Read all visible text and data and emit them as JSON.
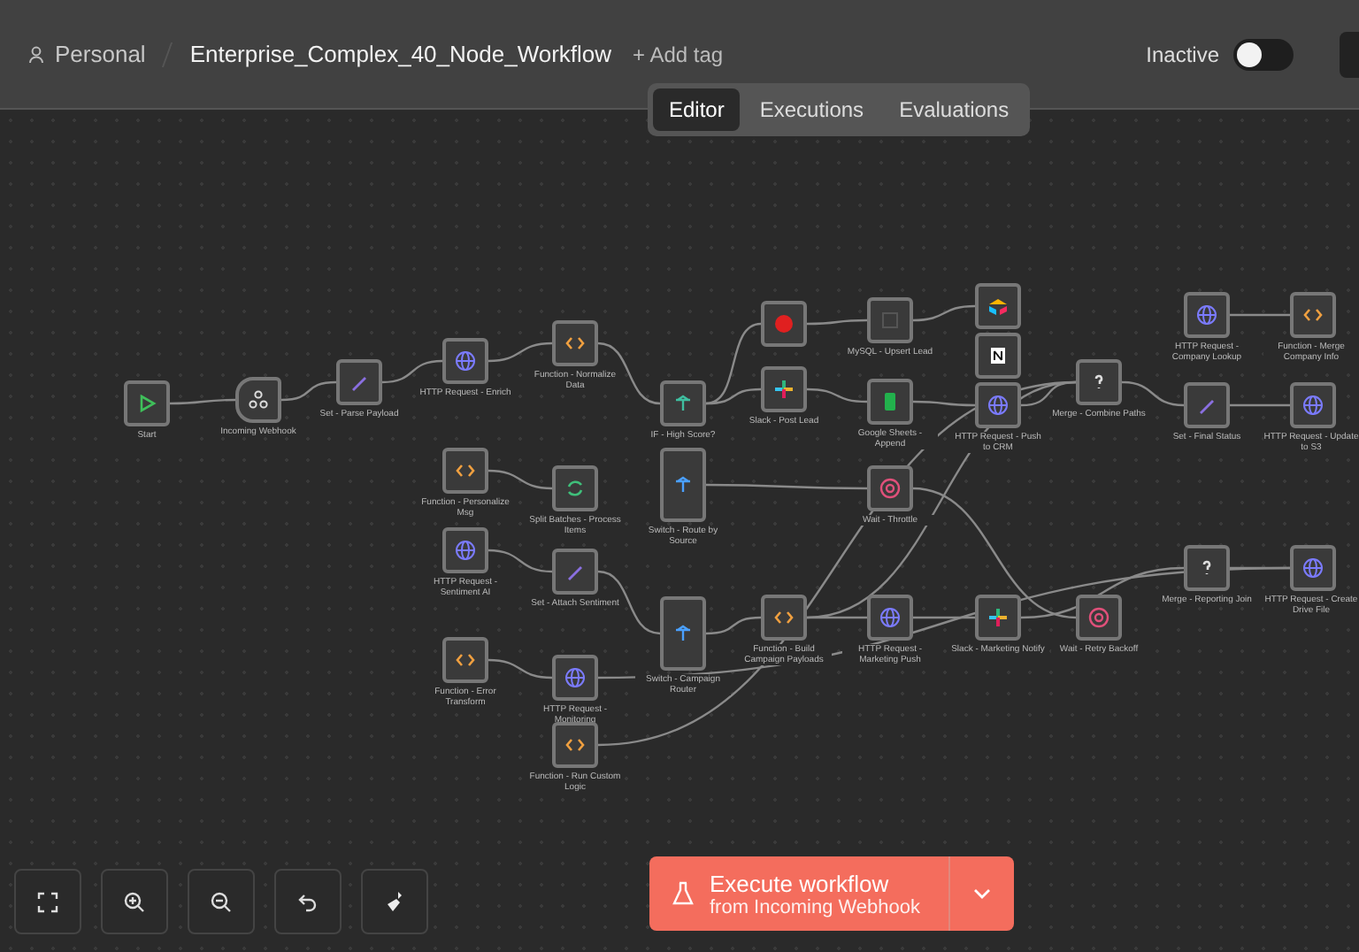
{
  "header": {
    "project": "Personal",
    "workflow_name": "Enterprise_Complex_40_Node_Workflow",
    "add_tag": "+ Add tag",
    "status_label": "Inactive",
    "active": false
  },
  "view_tabs": [
    {
      "label": "Editor",
      "selected": true
    },
    {
      "label": "Executions",
      "selected": false
    },
    {
      "label": "Evaluations",
      "selected": false
    }
  ],
  "nodes": [
    {
      "label": "Start",
      "kind": "start"
    },
    {
      "label": "Incoming Webhook",
      "kind": "webhook"
    },
    {
      "label": "Set - Parse Payload",
      "kind": "set"
    },
    {
      "label": "HTTP Request - Enrich",
      "kind": "http"
    },
    {
      "label": "Function - Personalize Msg",
      "kind": "function"
    },
    {
      "label": "HTTP Request - Sentiment AI",
      "kind": "http"
    },
    {
      "label": "Function - Error Transform",
      "kind": "function"
    },
    {
      "label": "Function - Normalize Data",
      "kind": "function"
    },
    {
      "label": "Split Batches - Process Items",
      "kind": "split"
    },
    {
      "label": "Set - Attach Sentiment",
      "kind": "set"
    },
    {
      "label": "HTTP Request - Monitoring",
      "kind": "http"
    },
    {
      "label": "Function - Run Custom Logic",
      "kind": "function"
    },
    {
      "label": "IF - High Score?",
      "kind": "if"
    },
    {
      "label": "Switch - Route by Source",
      "kind": "switch"
    },
    {
      "label": "Switch - Campaign Router",
      "kind": "switch"
    },
    {
      "kind": "alert"
    },
    {
      "label": "Slack - Post Lead",
      "kind": "slack"
    },
    {
      "label": "Function - Build Campaign Payloads",
      "kind": "function"
    },
    {
      "label": "MySQL - Upsert Lead",
      "kind": "mysql"
    },
    {
      "label": "Google Sheets - Append",
      "kind": "sheets"
    },
    {
      "label": "Wait - Throttle",
      "kind": "wait"
    },
    {
      "label": "HTTP Request - Marketing Push",
      "kind": "http"
    },
    {
      "kind": "airtable"
    },
    {
      "kind": "notion"
    },
    {
      "label": "HTTP Request - Push to CRM",
      "kind": "http"
    },
    {
      "label": "Slack - Marketing Notify",
      "kind": "slack"
    },
    {
      "label": "Merge - Combine Paths",
      "kind": "merge"
    },
    {
      "label": "Wait - Retry Backoff",
      "kind": "wait"
    },
    {
      "label": "HTTP Request - Company Lookup",
      "kind": "http"
    },
    {
      "label": "Set - Final Status",
      "kind": "set"
    },
    {
      "label": "Merge - Reporting Join",
      "kind": "merge"
    },
    {
      "label": "Function - Merge Company Info",
      "kind": "function"
    },
    {
      "label": "HTTP Request - Update to S3",
      "kind": "http"
    },
    {
      "label": "HTTP Request - Create Drive File",
      "kind": "http"
    }
  ],
  "execute_button": {
    "title": "Execute workflow",
    "subtitle": "from Incoming Webhook"
  }
}
